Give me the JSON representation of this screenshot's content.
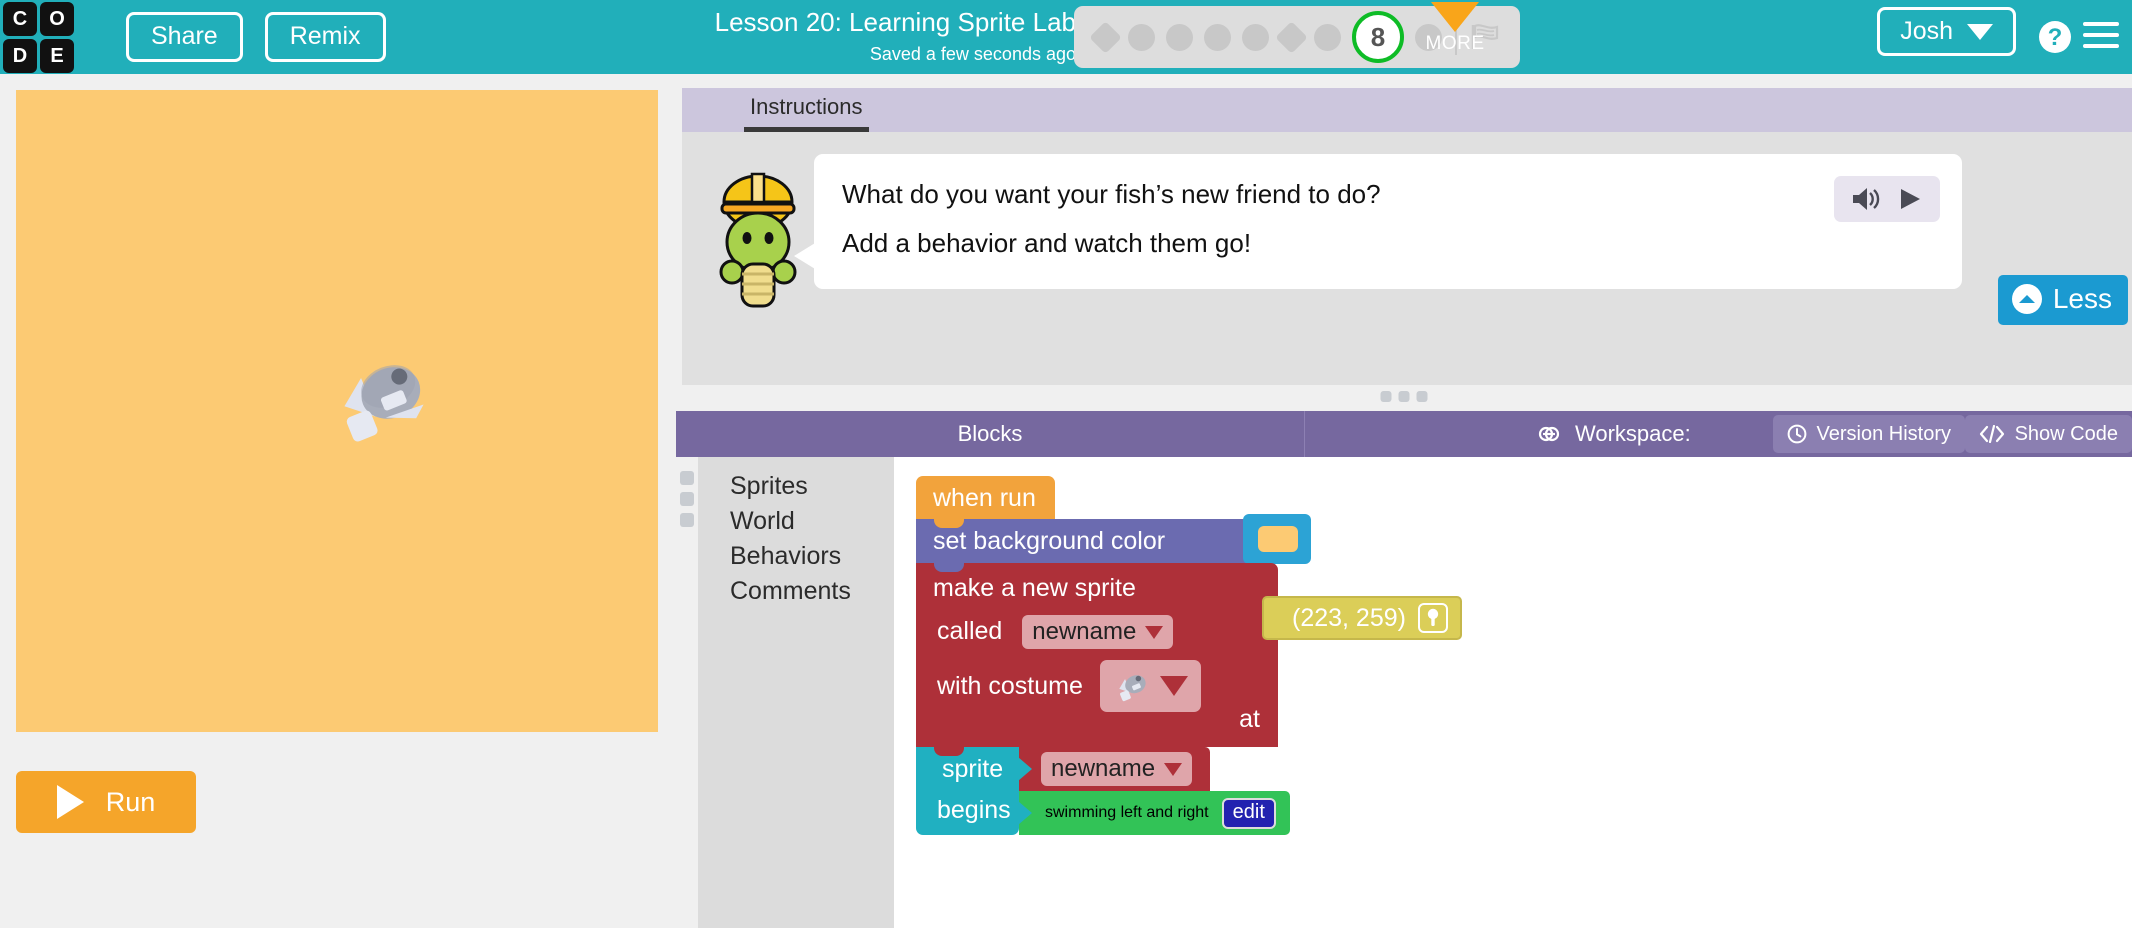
{
  "header": {
    "logo_letters": [
      "C",
      "O",
      "D",
      "E"
    ],
    "share_label": "Share",
    "remix_label": "Remix",
    "lesson_title": "Lesson 20: Learning Sprite Lab",
    "saved_status": "Saved a few seconds ago",
    "more_label": "MORE",
    "user_name": "Josh",
    "help_icon": "question-mark-circle-icon",
    "menu_icon": "hamburger-menu-icon",
    "background_color": "#21afba",
    "progress": {
      "current_level": "8",
      "bubbles": [
        {
          "shape": "diamond",
          "state": "incomplete"
        },
        {
          "shape": "circle",
          "state": "incomplete"
        },
        {
          "shape": "circle",
          "state": "incomplete"
        },
        {
          "shape": "circle",
          "state": "incomplete"
        },
        {
          "shape": "circle",
          "state": "incomplete"
        },
        {
          "shape": "diamond",
          "state": "incomplete"
        },
        {
          "shape": "circle",
          "state": "incomplete"
        },
        {
          "shape": "circle",
          "state": "current"
        },
        {
          "shape": "circle",
          "state": "incomplete"
        }
      ],
      "end_icon": "checkered-flag-icon",
      "current_color": "#0ebc26"
    }
  },
  "stage": {
    "background_color": "#fcca73",
    "sprite_icon": "gray-fish-sprite",
    "run_label": "Run",
    "run_icon": "play-triangle-icon",
    "run_color": "#f5a52a"
  },
  "instructions": {
    "tab_label": "Instructions",
    "mascot_icon": "construction-worker-mascot-icon",
    "line1": "What do you want your fish’s new friend to do?",
    "line2": "Add a behavior and watch them go!",
    "speaker_icon": "speaker-volume-icon",
    "play_icon": "play-triangle-icon",
    "less_label": "Less",
    "less_icon": "chevron-up-circle-icon",
    "less_color": "#1b9ad1"
  },
  "workspace_toolbar": {
    "blocks_label": "Blocks",
    "workspace_label": "Workspace:",
    "workspace_icon": "link-chain-icon",
    "version_history_label": "Version History",
    "version_history_icon": "clock-icon",
    "show_code_label": "Show Code",
    "show_code_icon": "code-brackets-icon",
    "background_color": "#76689f"
  },
  "palette": {
    "items": [
      {
        "label": "Sprites"
      },
      {
        "label": "World"
      },
      {
        "label": "Behaviors"
      },
      {
        "label": "Comments"
      }
    ]
  },
  "blocks": {
    "when_run": {
      "label": "when run",
      "color": "#f2a33c"
    },
    "set_background_color": {
      "label": "set background color",
      "color": "#6b6bb0",
      "swatch_color": "#fcca73",
      "socket_color": "#2ca3d5"
    },
    "make_new_sprite": {
      "title": "make a new sprite",
      "called_label": "called",
      "called_value": "newname",
      "costume_label": "with costume",
      "costume_value": "fish-costume-icon",
      "at_label": "at",
      "at_value": "(223, 259)",
      "at_picker_icon": "location-pin-icon",
      "color": "#ae3039",
      "at_color": "#dbce58"
    },
    "sprite_begins": {
      "sprite_label": "sprite",
      "sprite_value": "newname",
      "begins_label": "begins",
      "behavior_value": "swimming left and right",
      "edit_label": "edit",
      "color": "#20b0c1",
      "behavior_color": "#32c357",
      "edit_color": "#2222b0"
    }
  }
}
